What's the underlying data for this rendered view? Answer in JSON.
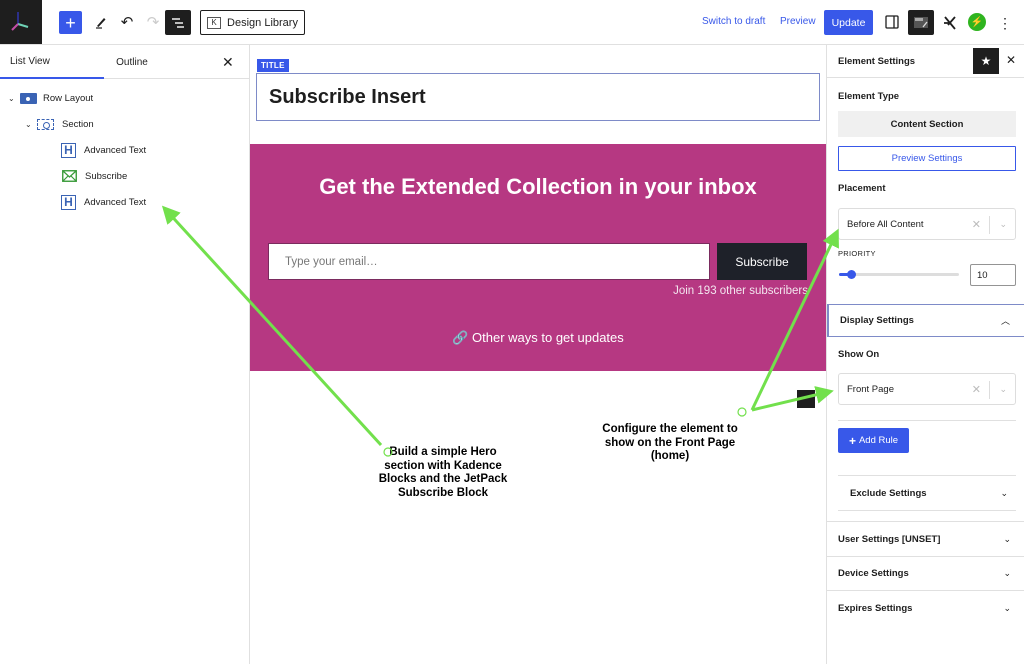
{
  "topbar": {
    "add_label": "+",
    "design_library": "Design Library",
    "switch_to_draft": "Switch to draft",
    "preview": "Preview",
    "update": "Update",
    "more": "⋮"
  },
  "left_panel": {
    "tabs": [
      "List View",
      "Outline"
    ],
    "close": "✕",
    "tree": [
      {
        "label": "Row Layout",
        "icon": "row-layout-icon",
        "level": 0
      },
      {
        "label": "Section",
        "icon": "section-icon",
        "level": 1
      },
      {
        "label": "Advanced Text",
        "icon": "heading-icon",
        "level": 2
      },
      {
        "label": "Subscribe",
        "icon": "mail-icon",
        "level": 2
      },
      {
        "label": "Advanced Text",
        "icon": "heading-icon",
        "level": 2
      }
    ]
  },
  "canvas": {
    "title_label": "TITLE",
    "title": "Subscribe Insert",
    "hero": {
      "heading": "Get the Extended Collection in your inbox",
      "email_placeholder": "Type your email…",
      "subscribe_button": "Subscribe",
      "join_text": "Join 193 other subscribers",
      "other_ways": "Other ways to get updates",
      "background": "#b63882"
    },
    "annotations": {
      "left": "Build a simple Hero section with Kadence Blocks and the JetPack Subscribe Block",
      "right": "Configure the element to show on the Front Page (home)",
      "arrow_color": "#72e04c"
    }
  },
  "right_panel": {
    "title": "Element Settings",
    "close": "✕",
    "element_type_label": "Element Type",
    "element_type": "Content Section",
    "preview_settings": "Preview Settings",
    "placement_label": "Placement",
    "placement_value": "Before All Content",
    "priority_label": "PRIORITY",
    "priority_value": "10",
    "priority_slider_fraction": 0.1,
    "display_settings": "Display Settings",
    "show_on_label": "Show On",
    "show_on_value": "Front Page",
    "add_rule": "Add Rule",
    "exclude_settings": "Exclude Settings",
    "sections": [
      "User Settings [UNSET]",
      "Device Settings",
      "Expires Settings"
    ]
  },
  "colors": {
    "accent": "#3858e9",
    "dark": "#1e1e1e",
    "jetpack": "#2fb41f"
  }
}
